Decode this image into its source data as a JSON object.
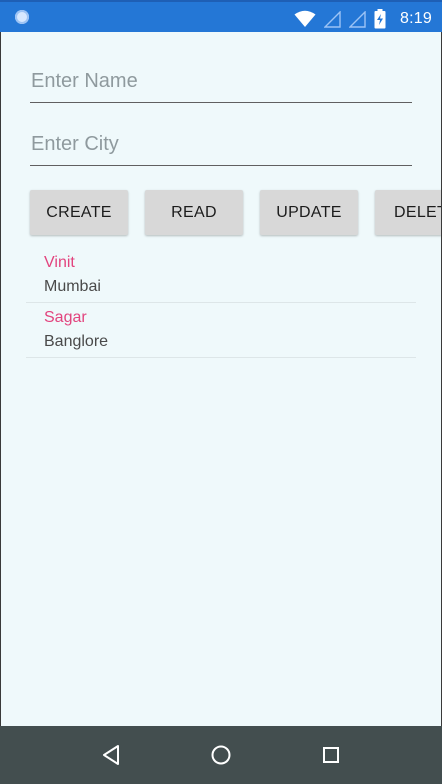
{
  "status_bar": {
    "time": "8:19",
    "icons": [
      "app-notification-icon",
      "wifi-icon",
      "signal-icon",
      "signal-icon",
      "battery-charging-icon"
    ]
  },
  "form": {
    "name_placeholder": "Enter Name",
    "city_placeholder": "Enter City"
  },
  "buttons": {
    "create": "CREATE",
    "read": "READ",
    "update": "UPDATE",
    "delete": "DELET"
  },
  "records": [
    {
      "name": "Vinit",
      "city": "Mumbai"
    },
    {
      "name": "Sagar",
      "city": "Banglore"
    }
  ],
  "nav_bar": {
    "icons": [
      "back-icon",
      "home-icon",
      "recents-icon"
    ]
  },
  "colors": {
    "status_bar": "#2477d6",
    "background": "#eff9fb",
    "record_name": "#e2447e",
    "nav_bar": "#434e4f"
  }
}
